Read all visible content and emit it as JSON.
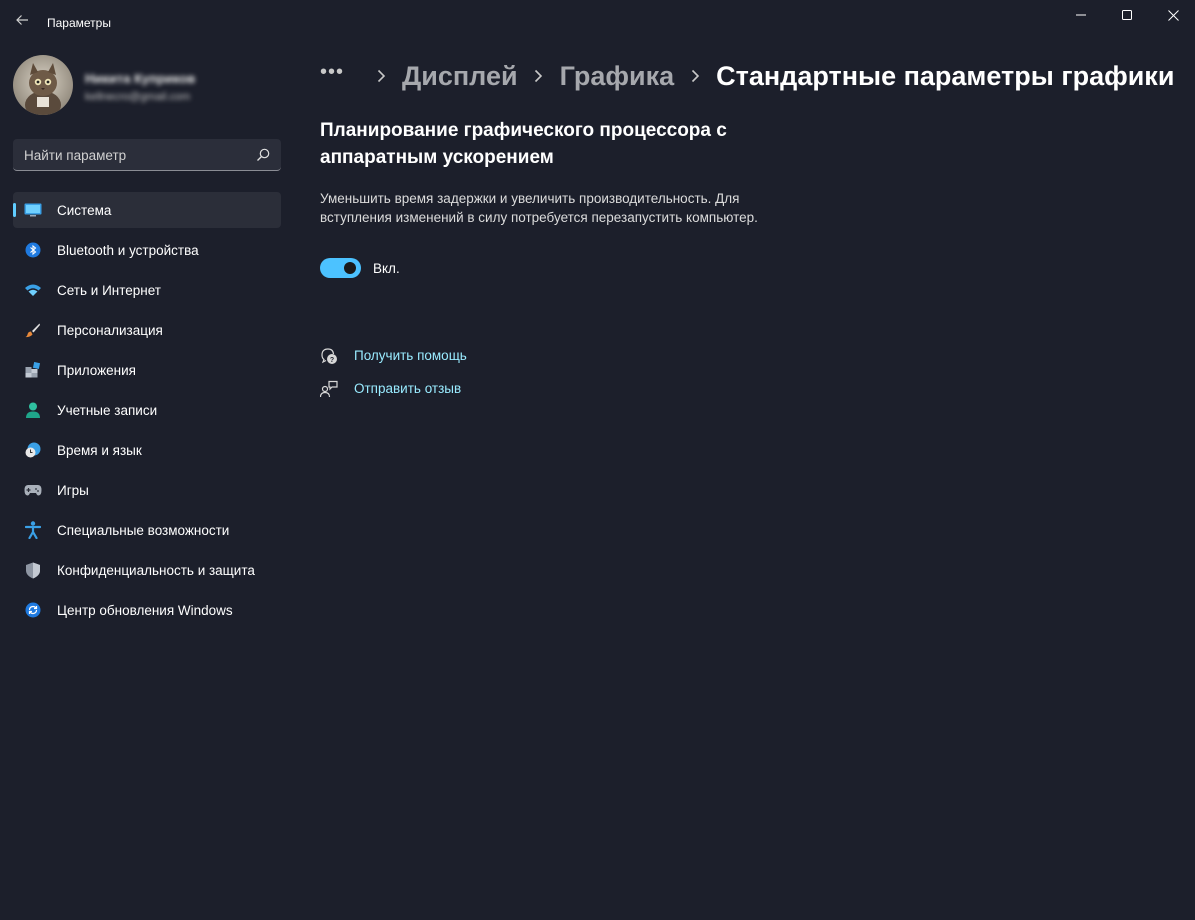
{
  "window": {
    "title": "Параметры"
  },
  "profile": {
    "name": "Никита Куприков",
    "email": "kellnecro@gmail.com"
  },
  "search": {
    "placeholder": "Найти параметр"
  },
  "sidebar": {
    "items": [
      {
        "label": "Система",
        "icon": "system-monitor-icon",
        "active": true
      },
      {
        "label": "Bluetooth и устройства",
        "icon": "bluetooth-icon"
      },
      {
        "label": "Сеть и Интернет",
        "icon": "wifi-icon"
      },
      {
        "label": "Персонализация",
        "icon": "brush-icon"
      },
      {
        "label": "Приложения",
        "icon": "apps-icon"
      },
      {
        "label": "Учетные записи",
        "icon": "person-icon"
      },
      {
        "label": "Время и язык",
        "icon": "globe-clock-icon"
      },
      {
        "label": "Игры",
        "icon": "gamepad-icon"
      },
      {
        "label": "Специальные возможности",
        "icon": "accessibility-icon"
      },
      {
        "label": "Конфиденциальность и защита",
        "icon": "shield-icon"
      },
      {
        "label": "Центр обновления Windows",
        "icon": "update-icon"
      }
    ]
  },
  "breadcrumb": {
    "more": "•••",
    "items": [
      "Дисплей",
      "Графика"
    ],
    "current": "Стандартные параметры графики"
  },
  "setting": {
    "title": "Планирование графического процессора с аппаратным ускорением",
    "description": "Уменьшить время задержки и увеличить производительность. Для вступления изменений в силу потребуется перезапустить компьютер.",
    "toggle_state": "Вкл.",
    "toggle_on": true
  },
  "links": {
    "help": "Получить помощь",
    "feedback": "Отправить отзыв"
  },
  "colors": {
    "accent": "#4cc2ff",
    "link": "#99ebff",
    "background": "#1c1f2b"
  }
}
